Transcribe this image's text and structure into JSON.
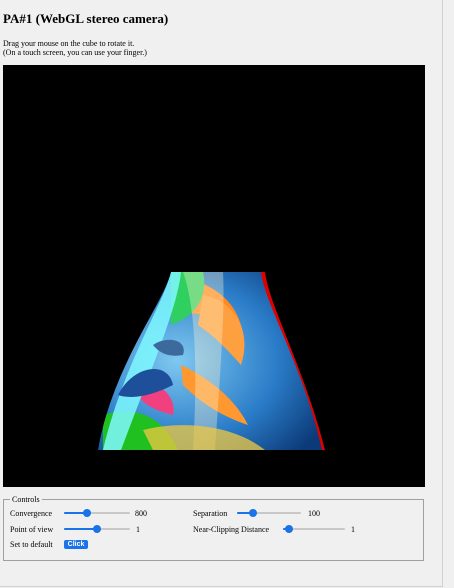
{
  "page": {
    "title": "PA#1 (WebGL stereo camera)",
    "intro_line1": "Drag your mouse on the cube to rotate it.",
    "intro_line2": "(On a touch screen, you can use your finger.)"
  },
  "controls": {
    "legend": "Controls",
    "convergence": {
      "label": "Convergence",
      "value": "800",
      "level": 0.35
    },
    "separation": {
      "label": "Separation",
      "value": "100",
      "level": 0.25
    },
    "point_of_view": {
      "label": "Point of view",
      "value": "1",
      "level": 0.5
    },
    "near_clipping": {
      "label": "Near-Clipping Distance",
      "value": "1",
      "level": 0.1
    },
    "set_default": {
      "label": "Set to default",
      "button": "Click"
    }
  },
  "colors": {
    "accent": "#1a73e8",
    "canvas_bg": "#000000",
    "anaglyph_left": "#ff0000",
    "anaglyph_right": "#00ffff"
  }
}
